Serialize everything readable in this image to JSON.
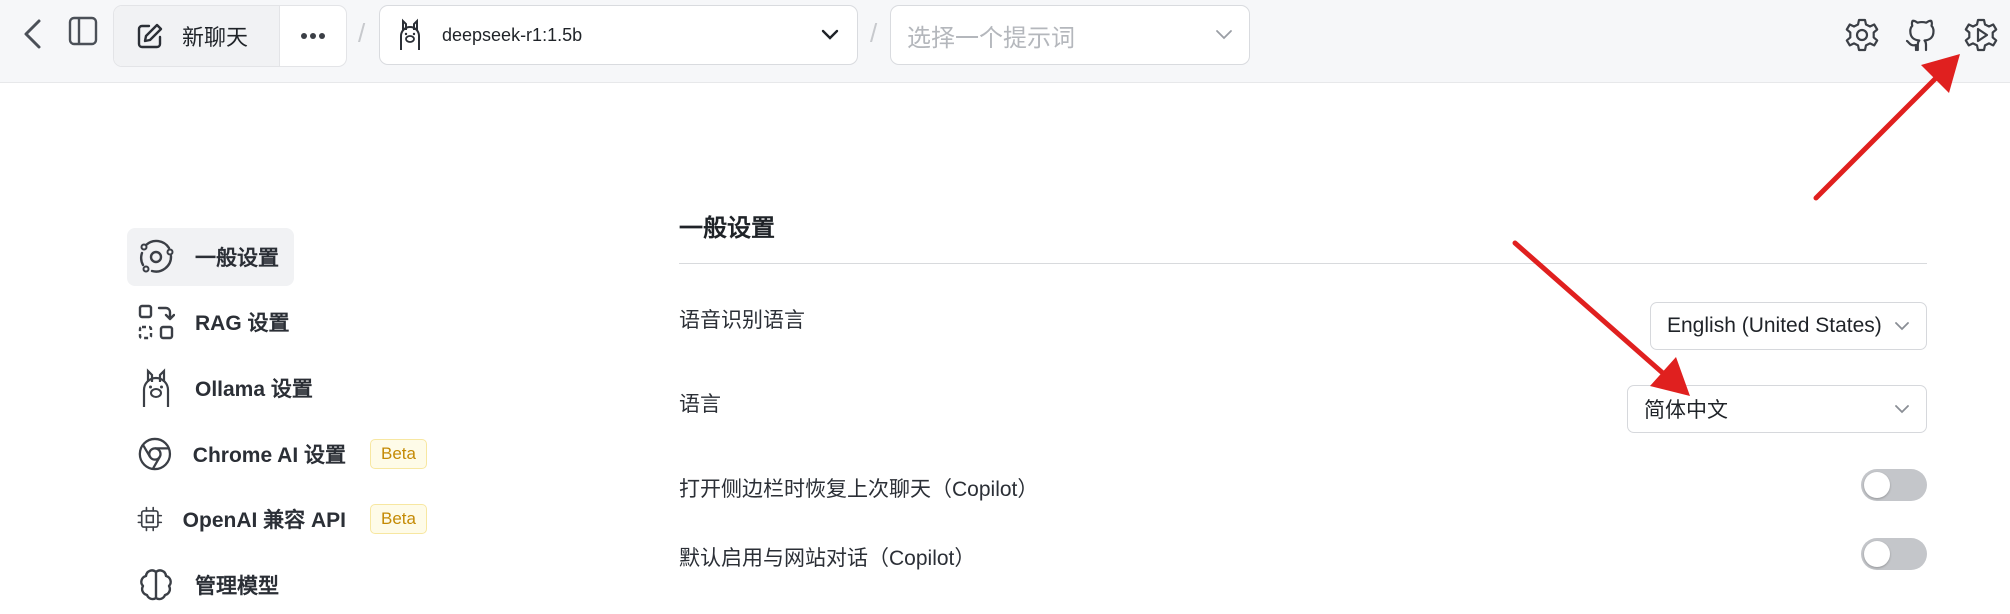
{
  "topbar": {
    "new_chat_label": "新聊天",
    "separator": "/",
    "model_label": "deepseek-r1:1.5b",
    "prompt_placeholder": "选择一个提示词"
  },
  "sidebar": {
    "items": [
      {
        "label": "一般设置",
        "icon": "settings-orbit-icon",
        "active": true
      },
      {
        "label": "RAG 设置",
        "icon": "rag-icon"
      },
      {
        "label": "Ollama 设置",
        "icon": "llama-icon"
      },
      {
        "label": "Chrome AI 设置",
        "icon": "chrome-icon",
        "badge": "Beta"
      },
      {
        "label": "OpenAI 兼容 API",
        "icon": "cpu-icon",
        "badge": "Beta"
      },
      {
        "label": "管理模型",
        "icon": "brain-icon"
      }
    ]
  },
  "main": {
    "title": "一般设置",
    "rows": [
      {
        "label": "语音识别语言",
        "value": "English (United States)"
      },
      {
        "label": "语言",
        "value": "简体中文"
      },
      {
        "label": "打开侧边栏时恢复上次聊天（Copilot）",
        "toggle": false
      },
      {
        "label": "默认启用与网站对话（Copilot）",
        "toggle": false
      }
    ]
  },
  "colors": {
    "accent_arrow": "#e0201f",
    "badge_text": "#c48a05",
    "toggle_off": "#c4c6ca"
  }
}
